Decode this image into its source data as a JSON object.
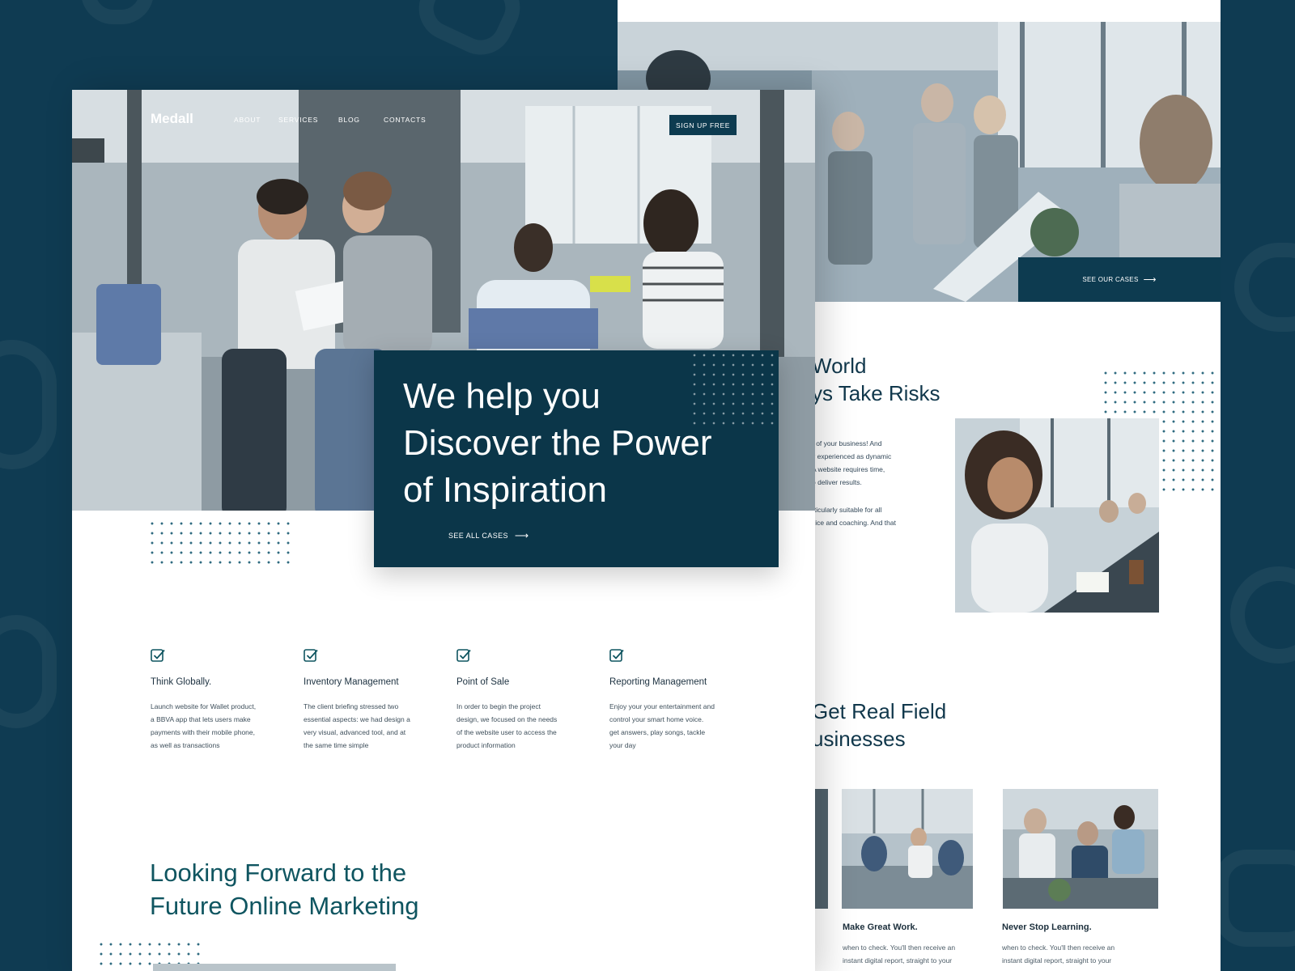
{
  "colors": {
    "background": "#0f3b52",
    "primary_dark": "#0b3649",
    "accent_teal": "#0f5560",
    "page": "#ffffff"
  },
  "front": {
    "logo": "Medall",
    "nav": [
      "ABOUT",
      "SERVICES",
      "BLOG",
      "CONTACTS"
    ],
    "signup_label": "SIGN UP FREE",
    "hero": {
      "title_lines": [
        "We help you",
        "Discover the Power",
        "of Inspiration"
      ],
      "cta_label": "SEE ALL CASES",
      "cta_icon": "arrow-right-icon"
    },
    "features": [
      {
        "icon": "checkbox-icon",
        "title": "Think Globally.",
        "text_lines": [
          "Launch website for Wallet product,",
          "a BBVA app that lets users make",
          "payments with their mobile phone,",
          "as well as transactions"
        ]
      },
      {
        "icon": "checkbox-icon",
        "title": "Inventory Management",
        "text_lines": [
          "The client briefing stressed two",
          "essential aspects: we had design a",
          "very visual, advanced tool, and at",
          "the same time simple"
        ]
      },
      {
        "icon": "checkbox-icon",
        "title": "Point of Sale",
        "text_lines": [
          "In order to begin the project",
          "design, we focused on the needs",
          "of the website user to access the",
          "product information"
        ]
      },
      {
        "icon": "checkbox-icon",
        "title": "Reporting Management",
        "text_lines": [
          "Enjoy your your entertainment and",
          "control your smart home voice.",
          "get answers, play songs, tackle",
          "your day"
        ]
      }
    ],
    "section_title_lines": [
      "Looking Forward to the",
      "Future Online Marketing"
    ]
  },
  "back": {
    "cases_label": "SEE OUR CASES",
    "heading1_lines": [
      "World",
      "ys Take Risks"
    ],
    "para1_lines": [
      "r of your business! And",
      "y experienced as dynamic",
      "A website requires time,",
      "o deliver results."
    ],
    "para2_lines": [
      "rticularly suitable for all",
      "vice and coaching. And that"
    ],
    "heading2_lines": [
      "Get Real Field",
      "usinesses"
    ],
    "cards": [
      {
        "title": "Make Great Work.",
        "text_lines": [
          "when to check. You'll then receive an",
          "instant digital report, straight to your"
        ]
      },
      {
        "title": "Never Stop Learning.",
        "text_lines": [
          "when to check. You'll then receive an",
          "instant digital report, straight to your"
        ]
      }
    ]
  }
}
